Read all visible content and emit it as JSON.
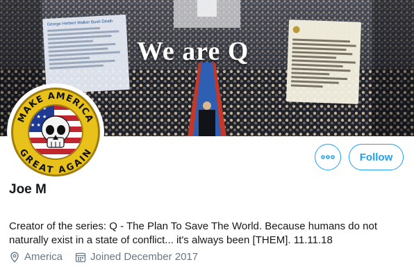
{
  "banner": {
    "headline": "We are Q",
    "doc_left_title": "George Herbert Walker Bush Death",
    "colors": {
      "aisle": "#2f5fb3",
      "carpet_edge": "#c0392b"
    }
  },
  "avatar": {
    "top_text": "MAKE AMERICA",
    "bottom_text": "GREAT AGAIN",
    "colors": {
      "ring": "#e8c21a",
      "ring_dark": "#a07d0a",
      "flag_red": "#c0262d",
      "flag_blue": "#1f3a93"
    }
  },
  "actions": {
    "more_icon": "more-horizontal-icon",
    "follow_label": "Follow"
  },
  "profile": {
    "name": "Joe M",
    "bio": "Creator of the series: Q - The Plan To Save The World. Because humans do not naturally exist in a state of conflict... it's always been [THEM]. 11.11.18",
    "location": "America",
    "location_icon": "location-pin-icon",
    "joined": "Joined December 2017",
    "joined_icon": "calendar-icon"
  },
  "theme": {
    "accent": "#1da1f2",
    "muted": "#657786",
    "text": "#14171a"
  }
}
